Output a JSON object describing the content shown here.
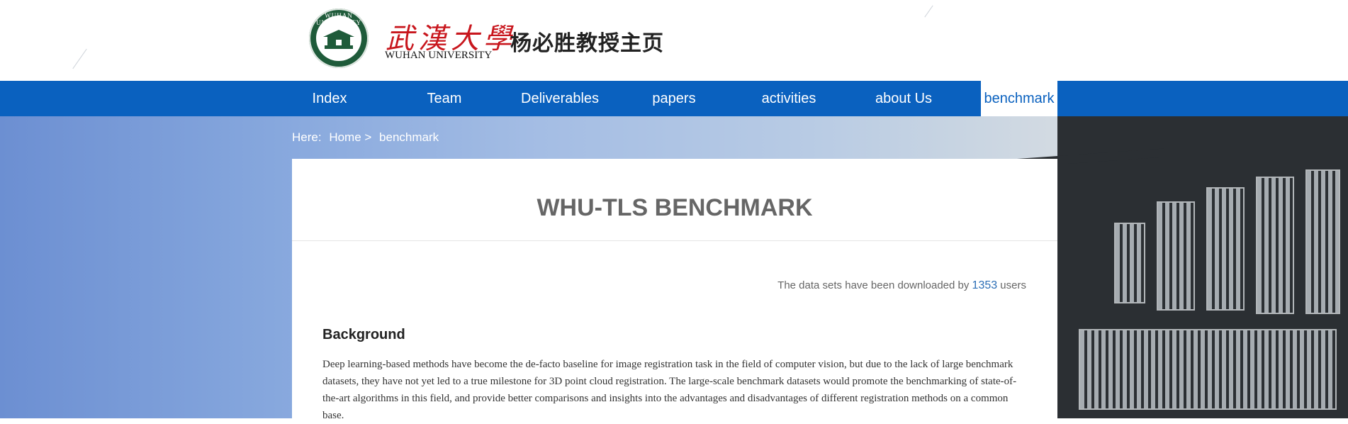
{
  "header": {
    "seal_text": "WUHAN UNIVERSITY",
    "logo_cn": "武漢大學",
    "logo_en": "WUHAN UNIVERSITY",
    "site_title": "杨必胜教授主页"
  },
  "nav": {
    "items": [
      {
        "label": "Index"
      },
      {
        "label": "Team"
      },
      {
        "label": "Deliverables"
      },
      {
        "label": "papers"
      },
      {
        "label": "activities"
      },
      {
        "label": "about Us"
      },
      {
        "label": "benchmark",
        "active": true
      }
    ],
    "active_color": "#0a61bf"
  },
  "breadcrumb": {
    "prefix": "Here:",
    "home": "Home >",
    "current": "benchmark"
  },
  "content": {
    "title": "WHU-TLS BENCHMARK",
    "downloads_prefix": "The data sets have been downloaded by ",
    "downloads_count": "1353",
    "downloads_suffix": " users",
    "section_heading": "Background",
    "paragraph": "Deep learning-based methods have become the de-facto baseline for image registration task in the field of computer vision, but due to the lack of large benchmark datasets, they have not yet led to a true milestone for 3D point cloud registration. The large-scale benchmark datasets would promote the benchmarking of state-of-the-art algorithms in this field, and provide better comparisons and insights into the advantages and disadvantages of different registration methods on a common base."
  },
  "colors": {
    "nav_bg": "#0a61bf",
    "link_blue": "#2a6db5",
    "logo_red": "#c8161d",
    "seal_green": "#1f5b3a"
  }
}
